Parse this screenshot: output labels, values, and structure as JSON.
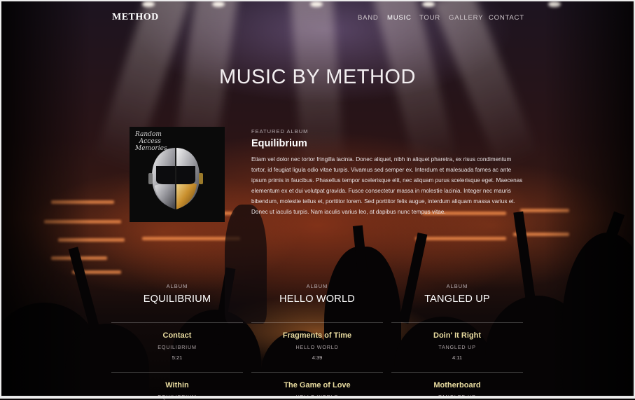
{
  "brand": "METHOD",
  "nav": [
    "BAND",
    "MUSIC",
    "TOUR",
    "GALLERY",
    "CONTACT"
  ],
  "active_nav": "MUSIC",
  "page_title": "MUSIC BY METHOD",
  "featured": {
    "kicker": "FEATURED ALBUM",
    "title": "Equilibrium",
    "cover_lettering": "Random Access Memories",
    "description": "Etiam vel dolor nec tortor fringilla lacinia. Donec aliquet, nibh in aliquet pharetra, ex risus condimentum tortor, id feugiat ligula odio vitae turpis. Vivamus sed semper ex. Interdum et malesuada fames ac ante ipsum primis in faucibus. Phasellus tempor scelerisque elit, nec aliquam purus scelerisque eget. Maecenas elementum ex et dui volutpat gravida. Fusce consectetur massa in molestie lacinia. Integer nec mauris bibendum, molestie tellus et, porttitor lorem. Sed porttitor felis augue, interdum aliquam massa varius et. Donec ut iaculis turpis. Nam iaculis varius leo, at dapibus nunc tempus vitae."
  },
  "albums": [
    {
      "kicker": "ALBUM",
      "title": "EQUILIBRIUM",
      "tracks": [
        {
          "title": "Contact",
          "album": "EQUILIBRIUM",
          "time": "5:21"
        },
        {
          "title": "Within",
          "album": "EQUILIBRIUM",
          "time": ""
        }
      ]
    },
    {
      "kicker": "ALBUM",
      "title": "HELLO WORLD",
      "tracks": [
        {
          "title": "Fragments of Time",
          "album": "HELLO WORLD",
          "time": "4:39"
        },
        {
          "title": "The Game of Love",
          "album": "HELLO WORLD",
          "time": ""
        }
      ]
    },
    {
      "kicker": "ALBUM",
      "title": "TANGLED UP",
      "tracks": [
        {
          "title": "Doin' It Right",
          "album": "TANGLED UP",
          "time": "4:11"
        },
        {
          "title": "Motherboard",
          "album": "TANGLED UP",
          "time": ""
        }
      ]
    }
  ]
}
